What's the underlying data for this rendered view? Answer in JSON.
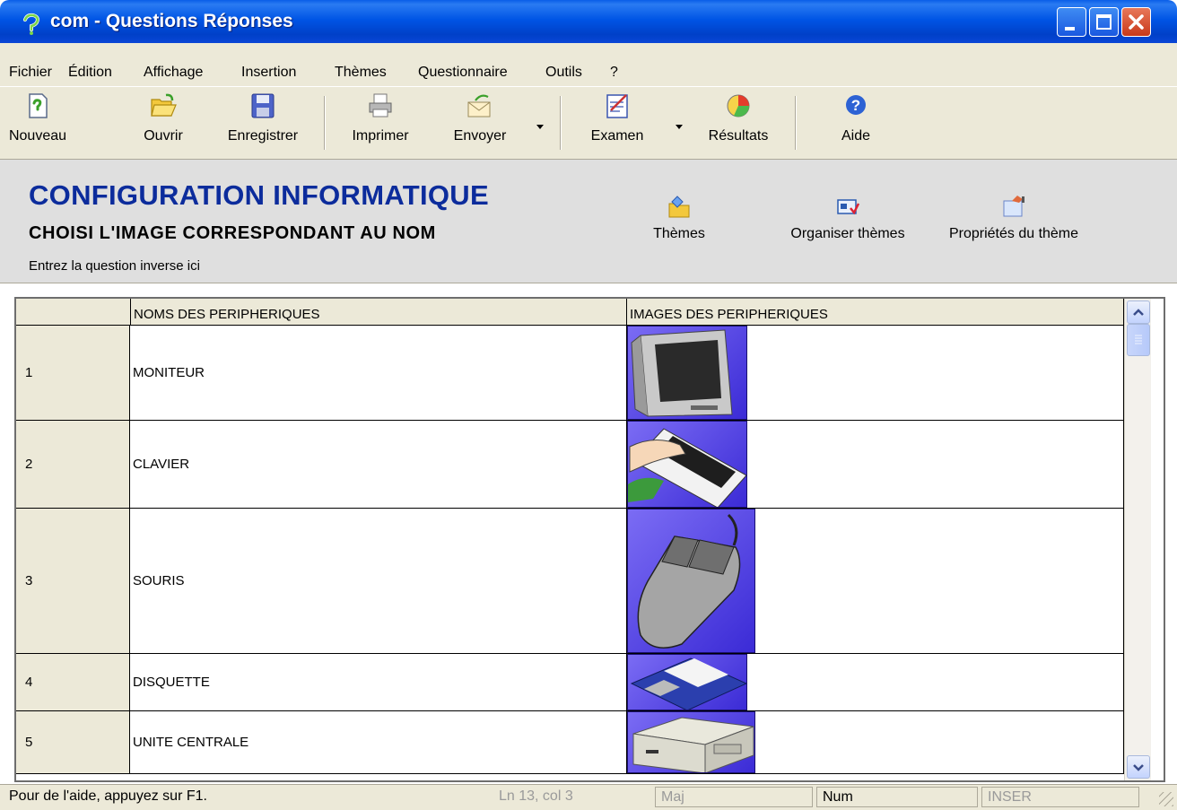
{
  "window": {
    "title": "com - Questions Réponses"
  },
  "menu": [
    "Fichier",
    "Édition",
    "Affichage",
    "Insertion",
    "Thèmes",
    "Questionnaire",
    "Outils",
    "?"
  ],
  "toolbar": {
    "nouveau": "Nouveau",
    "ouvrir": "Ouvrir",
    "enregistrer": "Enregistrer",
    "imprimer": "Imprimer",
    "envoyer": "Envoyer",
    "examen": "Examen",
    "resultats": "Résultats",
    "aide": "Aide"
  },
  "header": {
    "title": "CONFIGURATION INFORMATIQUE",
    "subtitle": "CHOISI L'IMAGE CORRESPONDANT AU NOM",
    "inverse": "Entrez la question inverse ici",
    "themes": "Thèmes",
    "organiser": "Organiser thèmes",
    "proprietes": "Propriétés du thème"
  },
  "table": {
    "col_names": "NOMS DES PERIPHERIQUES",
    "col_images": "IMAGES DES PERIPHERIQUES",
    "rows": [
      {
        "num": "1",
        "name": "MONITEUR",
        "image": "monitor-image"
      },
      {
        "num": "2",
        "name": "CLAVIER",
        "image": "keyboard-image"
      },
      {
        "num": "3",
        "name": "SOURIS",
        "image": "mouse-image"
      },
      {
        "num": "4",
        "name": "DISQUETTE",
        "image": "floppy-image"
      },
      {
        "num": "5",
        "name": "UNITE CENTRALE",
        "image": "cpu-unit-image"
      }
    ]
  },
  "status": {
    "help": "Pour de l'aide, appuyez sur F1.",
    "position": "Ln 13, col 3",
    "maj": "Maj",
    "num": "Num",
    "inser": "INSER"
  },
  "colors": {
    "titlebar": "#0055e5",
    "chrome": "#ece9d8",
    "header_title": "#0c2c9c",
    "image_bg": "#5a4be8"
  }
}
